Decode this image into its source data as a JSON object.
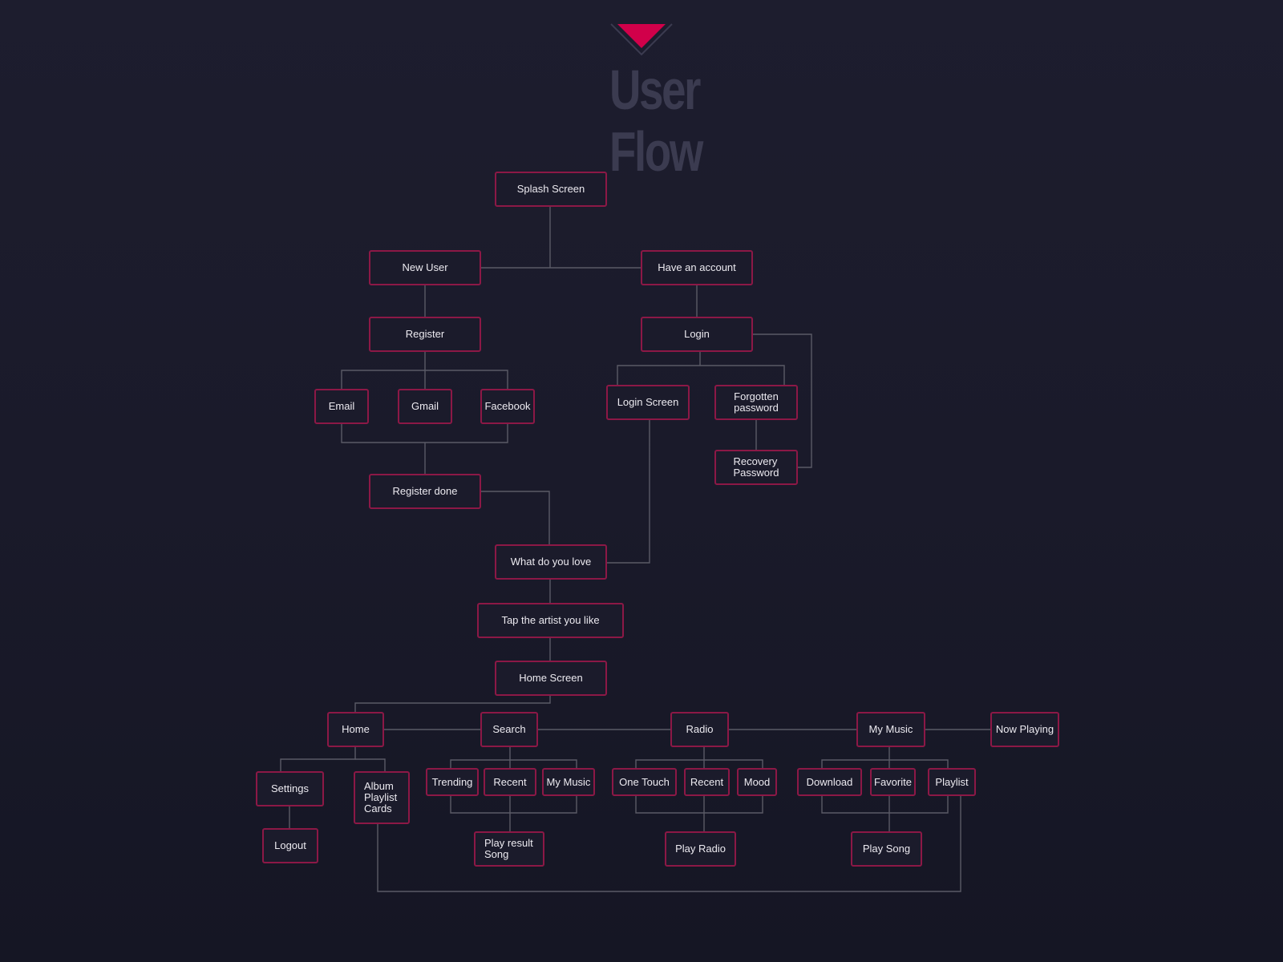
{
  "title": "User Flow",
  "colors": {
    "accent": "#d1004a",
    "node_border": "#8c1846",
    "wire": "#5a5a66",
    "title": "#3b3b50",
    "background": "#1b1b2b"
  },
  "nodes": {
    "splash": "Splash Screen",
    "new_user": "New User",
    "have_account": "Have an account",
    "register": "Register",
    "login": "Login",
    "email": "Email",
    "gmail": "Gmail",
    "facebook": "Facebook",
    "login_screen": "Login Screen",
    "forgotten": "Forgotten\npassword",
    "recovery": "Recovery\nPassword",
    "register_done": "Register done",
    "what_love": "What do you love",
    "tap_artist": "Tap the artist you like",
    "home_screen": "Home Screen",
    "home": "Home",
    "search": "Search",
    "radio": "Radio",
    "my_music": "My Music",
    "now_playing": "Now Playing",
    "settings": "Settings",
    "album_cards": "Album\nPlaylist\nCards",
    "logout": "Logout",
    "trending": "Trending",
    "search_recent": "Recent",
    "search_my_music": "My Music",
    "play_result": "Play result\nSong",
    "one_touch": "One Touch",
    "radio_recent": "Recent",
    "mood": "Mood",
    "play_radio": "Play Radio",
    "download": "Download",
    "favorite": "Favorite",
    "playlist": "Playlist",
    "play_song": "Play Song"
  }
}
